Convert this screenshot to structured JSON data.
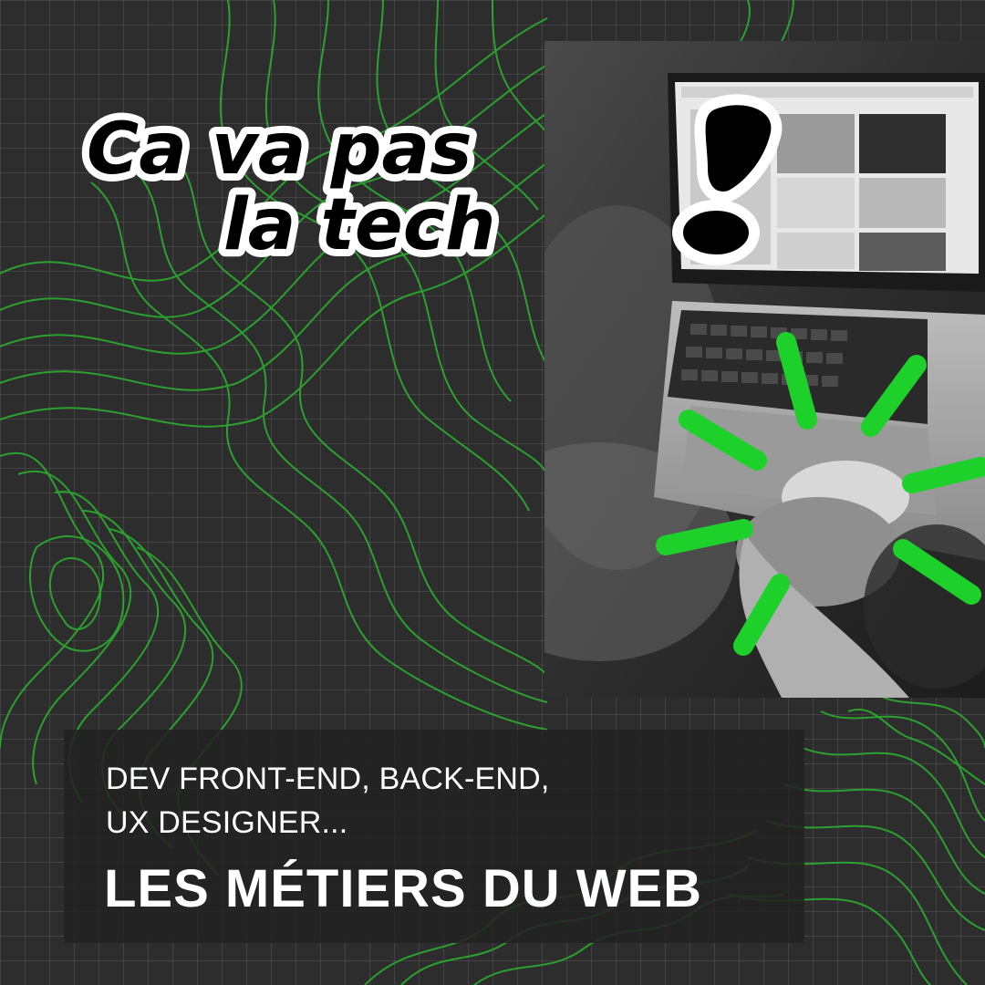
{
  "logo": {
    "line1": "Ca va pas",
    "line2": "la tech",
    "mark": "!"
  },
  "caption": {
    "subtitle_line1": "DEV FRONT-END, BACK-END,",
    "subtitle_line2": "UX DESIGNER...",
    "headline": "LES MÉTIERS DU WEB"
  },
  "colors": {
    "background": "#2d2d2d",
    "accent_green": "#1ed12a",
    "contour_green": "#2bb52f",
    "text": "#ffffff",
    "logo_fill": "#000000",
    "logo_outline": "#ffffff"
  },
  "icons": {
    "photo": "laptop-photo",
    "sparks": "sparkle-burst-icon",
    "grid": "grid-background",
    "contours": "topographic-lines"
  }
}
